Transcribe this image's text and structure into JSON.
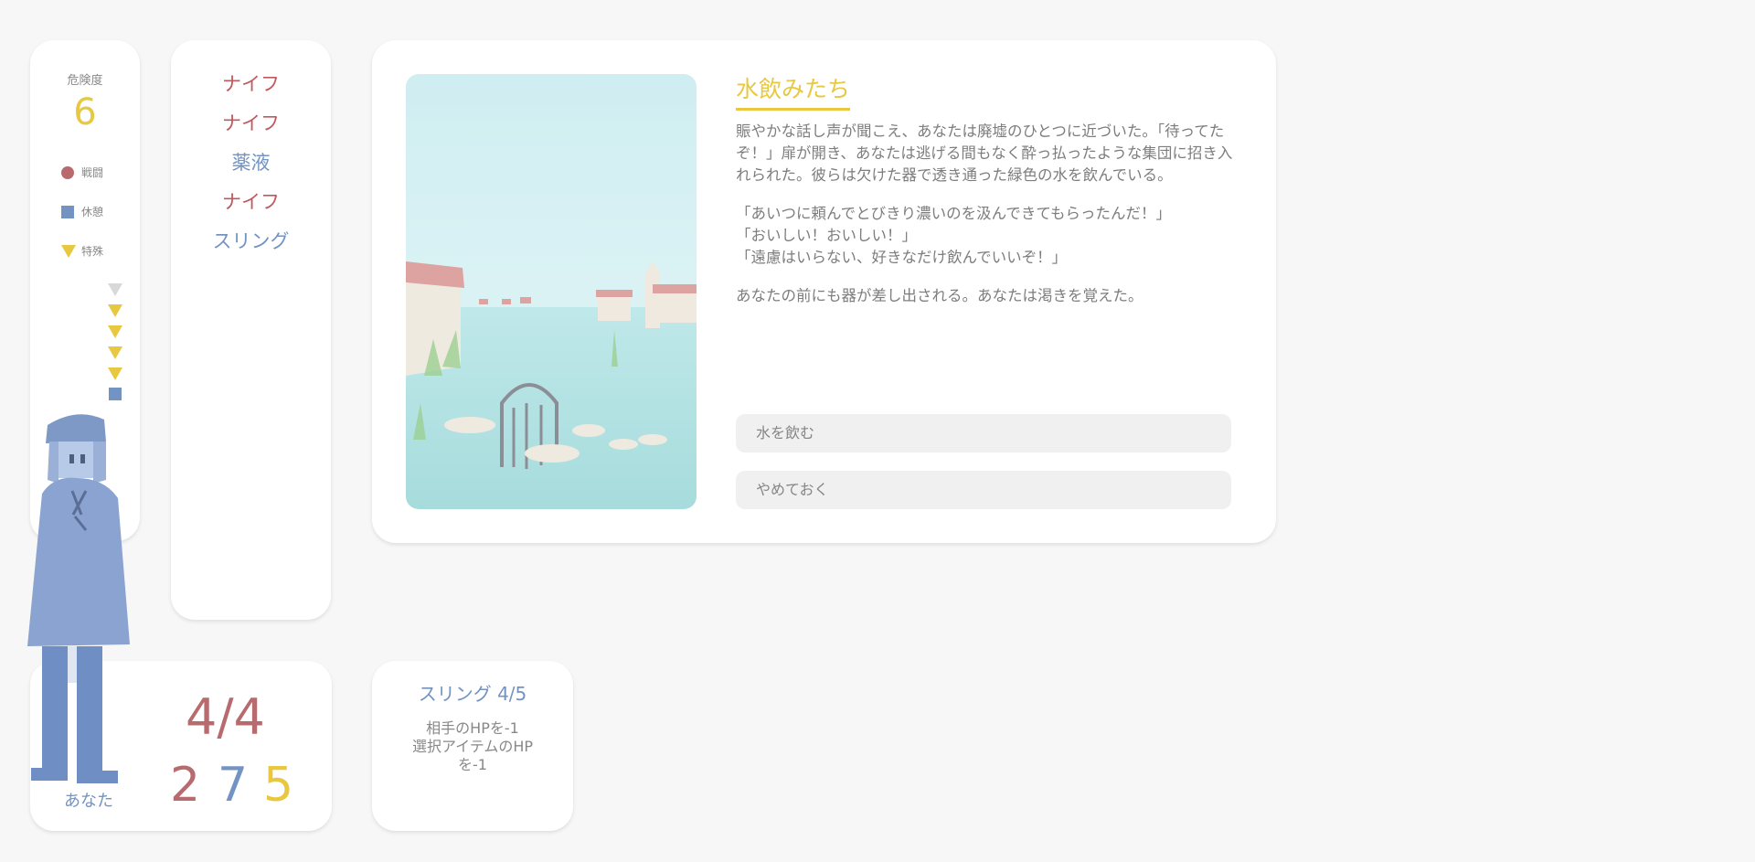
{
  "danger": {
    "label": "危険度",
    "value": "6",
    "legend": [
      {
        "shape": "circle",
        "label": "戦闘",
        "color": "#b86b6e"
      },
      {
        "shape": "square",
        "label": "休憩",
        "color": "#7393c2"
      },
      {
        "shape": "triangle",
        "label": "特殊",
        "color": "#e8c840"
      }
    ]
  },
  "items": [
    {
      "name": "ナイフ",
      "color": "#c0585c"
    },
    {
      "name": "ナイフ",
      "color": "#c0585c"
    },
    {
      "name": "薬液",
      "color": "#7393c2"
    },
    {
      "name": "ナイフ",
      "color": "#c0585c"
    },
    {
      "name": "スリング",
      "color": "#7393c2"
    }
  ],
  "event": {
    "title": "水飲みたち",
    "paragraphs": [
      "賑やかな話し声が聞こえ、あなたは廃墟のひとつに近づいた。「待ってたぞ！」扉が開き、あなたは逃げる間もなく酔っ払ったような集団に招き入れられた。彼らは欠けた器で透き通った緑色の水を飲んでいる。",
      "「あいつに頼んでとびきり濃いのを汲んできてもらったんだ！」\n「おいしい！おいしい！」\n「遠慮はいらない、好きなだけ飲んでいいぞ！」",
      "あなたの前にも器が差し出される。あなたは渇きを覚えた。"
    ],
    "choices": [
      "水を飲む",
      "やめておく"
    ]
  },
  "player": {
    "hp": "4/4",
    "stats": [
      {
        "value": "2",
        "color": "#b86b6e"
      },
      {
        "value": "7",
        "color": "#7393c2"
      },
      {
        "value": "5",
        "color": "#e8c840"
      }
    ],
    "name": "あなた"
  },
  "skill": {
    "name": "スリング 4/5",
    "desc": "相手のHPを-1\n選択アイテムのHP\nを-1"
  },
  "icons": {
    "scene": "ruins-lake-scene",
    "character": "hooded-character"
  },
  "colors": {
    "red": "#b86b6e",
    "blue": "#7393c2",
    "yellow": "#e8c840"
  }
}
